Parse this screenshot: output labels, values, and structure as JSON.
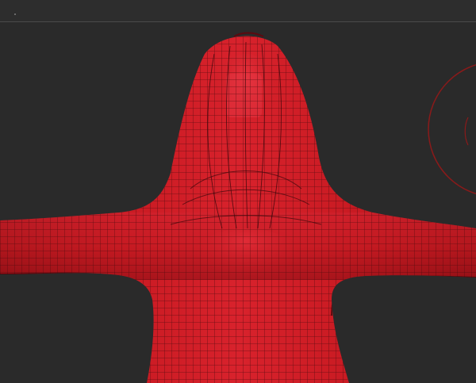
{
  "app": {
    "title": ""
  },
  "viewport": {
    "background": "#2a2a2a",
    "model": {
      "name": "red-humanoid-mesh",
      "base_color": "#c81a22",
      "highlight_color": "#e43040",
      "shadow_color": "#8c0e14",
      "wire_color": "#4a0a0e",
      "wireframe": true
    },
    "gizmo": {
      "color": "#8a1a1a",
      "icon": "rotate-circle-icon"
    }
  }
}
